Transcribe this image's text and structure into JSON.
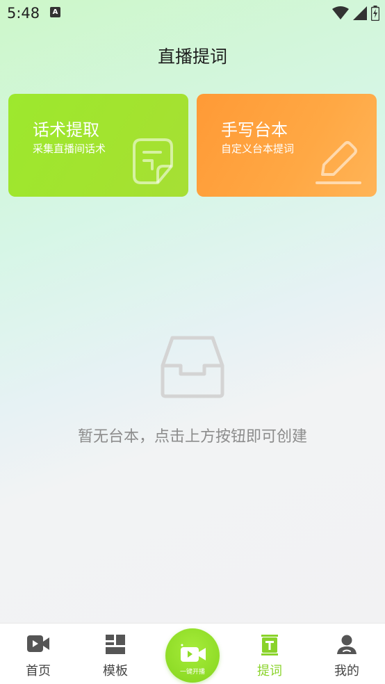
{
  "status_bar": {
    "time": "5:48",
    "notification_badge": "A"
  },
  "header": {
    "title": "直播提词"
  },
  "cards": [
    {
      "title": "话术提取",
      "subtitle": "采集直播间话术",
      "icon": "sticky-note-icon",
      "color": "#9de82e"
    },
    {
      "title": "手写台本",
      "subtitle": "自定义台本提词",
      "icon": "pencil-icon",
      "color": "#ff9a36"
    }
  ],
  "empty_state": {
    "icon": "inbox-tray-icon",
    "message": "暂无台本，点击上方按钮即可创建"
  },
  "tabbar": {
    "tabs": [
      {
        "label": "首页",
        "icon": "video-camera-icon"
      },
      {
        "label": "模板",
        "icon": "template-grid-icon"
      },
      {
        "label": "一键开播",
        "icon": "live-camera-icon"
      },
      {
        "label": "提词",
        "icon": "teleprompter-icon",
        "active": true
      },
      {
        "label": "我的",
        "icon": "user-icon"
      }
    ],
    "active_color": "#8ad32a"
  }
}
